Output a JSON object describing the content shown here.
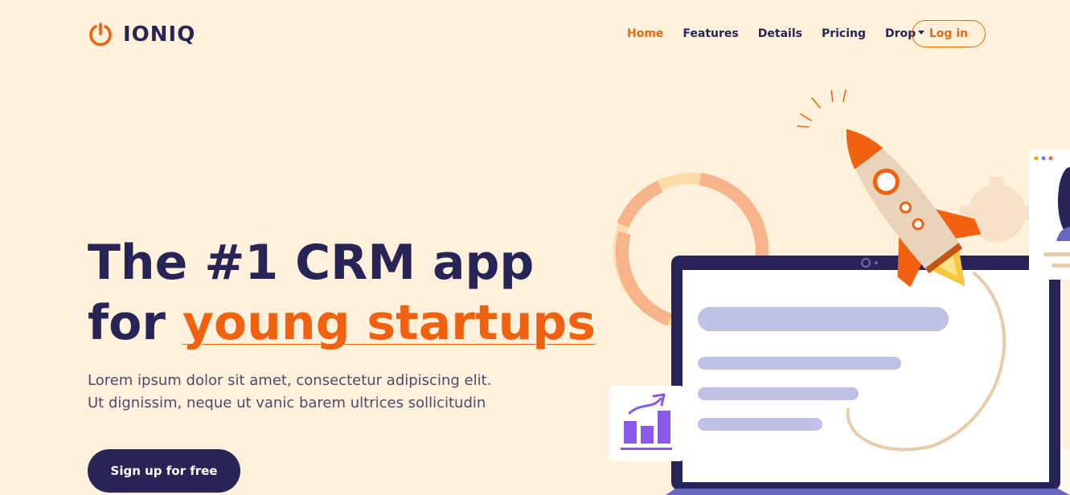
{
  "brand": {
    "name": "IONIQ",
    "icon": "power-icon",
    "accent": "#f0620f",
    "navy": "#272556"
  },
  "nav": {
    "items": [
      {
        "label": "Home",
        "active": true
      },
      {
        "label": "Features"
      },
      {
        "label": "Details"
      },
      {
        "label": "Pricing"
      },
      {
        "label": "Drop",
        "dropdown": true
      }
    ],
    "login_label": "Log in"
  },
  "hero": {
    "title_line1": "The #1 CRM app",
    "title_line2_prefix": "for ",
    "title_highlight": "young startups",
    "subtitle": "Lorem ipsum dolor sit amet, consectetur adipiscing elit. Ut dignissim, neque ut vanic barem ultrices sollicitudin",
    "cta_label": "Sign up for free"
  },
  "illustration": {
    "icons": [
      "rocket-icon",
      "donut-chart-icon",
      "laptop-icon",
      "bar-chart-growth-icon",
      "gear-icon",
      "profile-card-icon"
    ]
  }
}
